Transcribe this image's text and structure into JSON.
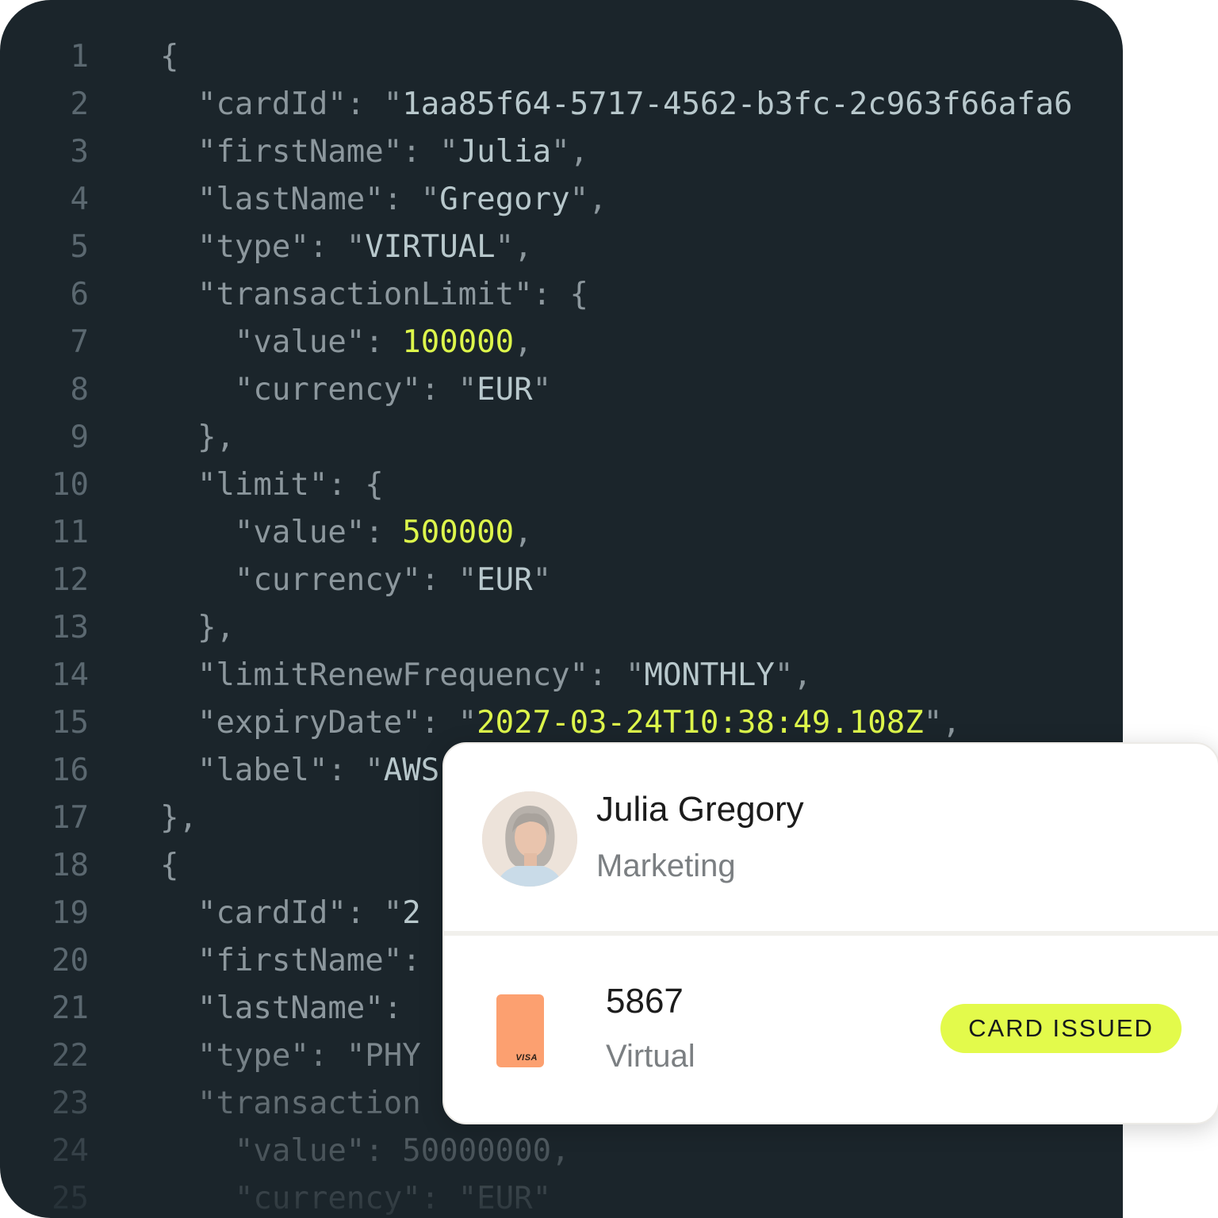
{
  "code_lines": [
    {
      "n": "1",
      "parts": [
        {
          "t": "{",
          "k": "p"
        }
      ]
    },
    {
      "n": "2",
      "parts": [
        {
          "t": "  \"cardId\": ",
          "k": "k"
        },
        {
          "t": "\"",
          "k": "p"
        },
        {
          "t": "1aa85f64-5717-4562-b3fc-2c963f66afa6",
          "k": "v"
        }
      ]
    },
    {
      "n": "3",
      "parts": [
        {
          "t": "  \"firstName\": ",
          "k": "k"
        },
        {
          "t": "\"",
          "k": "p"
        },
        {
          "t": "Julia",
          "k": "v"
        },
        {
          "t": "\",",
          "k": "p"
        }
      ]
    },
    {
      "n": "4",
      "parts": [
        {
          "t": "  \"lastName\": ",
          "k": "k"
        },
        {
          "t": "\"",
          "k": "p"
        },
        {
          "t": "Gregory",
          "k": "v"
        },
        {
          "t": "\",",
          "k": "p"
        }
      ]
    },
    {
      "n": "5",
      "parts": [
        {
          "t": "  \"type\": ",
          "k": "k"
        },
        {
          "t": "\"",
          "k": "p"
        },
        {
          "t": "VIRTUAL",
          "k": "v"
        },
        {
          "t": "\",",
          "k": "p"
        }
      ]
    },
    {
      "n": "6",
      "parts": [
        {
          "t": "  \"transactionLimit\": {",
          "k": "k"
        }
      ]
    },
    {
      "n": "7",
      "parts": [
        {
          "t": "    \"value\": ",
          "k": "k"
        },
        {
          "t": "100000",
          "k": "n"
        },
        {
          "t": ",",
          "k": "p"
        }
      ]
    },
    {
      "n": "8",
      "parts": [
        {
          "t": "    \"currency\": ",
          "k": "k"
        },
        {
          "t": "\"",
          "k": "p"
        },
        {
          "t": "EUR",
          "k": "v"
        },
        {
          "t": "\"",
          "k": "p"
        }
      ]
    },
    {
      "n": "9",
      "parts": [
        {
          "t": "  },",
          "k": "p"
        }
      ]
    },
    {
      "n": "10",
      "parts": [
        {
          "t": "  \"limit\": {",
          "k": "k"
        }
      ]
    },
    {
      "n": "11",
      "parts": [
        {
          "t": "    \"value\": ",
          "k": "k"
        },
        {
          "t": "500000",
          "k": "n"
        },
        {
          "t": ",",
          "k": "p"
        }
      ]
    },
    {
      "n": "12",
      "parts": [
        {
          "t": "    \"currency\": ",
          "k": "k"
        },
        {
          "t": "\"",
          "k": "p"
        },
        {
          "t": "EUR",
          "k": "v"
        },
        {
          "t": "\"",
          "k": "p"
        }
      ]
    },
    {
      "n": "13",
      "parts": [
        {
          "t": "  },",
          "k": "p"
        }
      ]
    },
    {
      "n": "14",
      "parts": [
        {
          "t": "  \"limitRenewFrequency\": ",
          "k": "k"
        },
        {
          "t": "\"",
          "k": "p"
        },
        {
          "t": "MONTHLY",
          "k": "v"
        },
        {
          "t": "\",",
          "k": "p"
        }
      ]
    },
    {
      "n": "15",
      "parts": [
        {
          "t": "  \"expiryDate\": ",
          "k": "k"
        },
        {
          "t": "\"",
          "k": "p"
        },
        {
          "t": "2027-03-24T10:38:49.108Z",
          "k": "n"
        },
        {
          "t": "\",",
          "k": "p"
        }
      ]
    },
    {
      "n": "16",
      "parts": [
        {
          "t": "  \"label\": ",
          "k": "k"
        },
        {
          "t": "\"",
          "k": "p"
        },
        {
          "t": "AWS",
          "k": "v"
        }
      ]
    },
    {
      "n": "17",
      "parts": [
        {
          "t": "},",
          "k": "p"
        }
      ]
    },
    {
      "n": "18",
      "parts": [
        {
          "t": "{",
          "k": "p"
        }
      ]
    },
    {
      "n": "19",
      "parts": [
        {
          "t": "  \"cardId\": ",
          "k": "k"
        },
        {
          "t": "\"",
          "k": "p"
        },
        {
          "t": "2",
          "k": "v"
        }
      ]
    },
    {
      "n": "20",
      "parts": [
        {
          "t": "  \"firstName\":",
          "k": "k"
        }
      ]
    },
    {
      "n": "21",
      "parts": [
        {
          "t": "  \"lastName\": ",
          "k": "k"
        }
      ]
    },
    {
      "n": "22",
      "parts": [
        {
          "t": "  \"type\": ",
          "k": "k"
        },
        {
          "t": "\"PHY",
          "k": "p"
        }
      ]
    },
    {
      "n": "23",
      "parts": [
        {
          "t": "  \"transaction",
          "k": "k"
        }
      ]
    },
    {
      "n": "24",
      "parts": [
        {
          "t": "    \"value\": ",
          "k": "k"
        },
        {
          "t": "50000000,",
          "k": "p"
        }
      ]
    },
    {
      "n": "25",
      "parts": [
        {
          "t": "    \"currency\": ",
          "k": "k"
        },
        {
          "t": "\"EUR\"",
          "k": "p"
        }
      ]
    }
  ],
  "card": {
    "name": "Julia Gregory",
    "department": "Marketing",
    "card_last4": "5867",
    "card_type": "Virtual",
    "card_brand": "VISA",
    "status": "CARD ISSUED"
  },
  "colors": {
    "editor_bg": "#1b252b",
    "string_value": "#b8c8cc",
    "number_value": "#ddf64b",
    "card_icon": "#fca070",
    "badge_bg": "#e3fa4b"
  }
}
